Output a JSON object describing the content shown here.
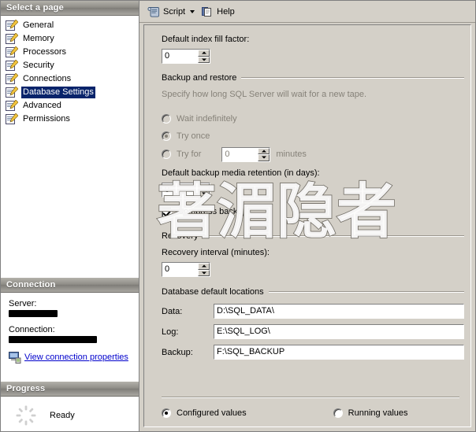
{
  "sidebar": {
    "header": "Select a page",
    "items": [
      {
        "label": "General",
        "icon": "page-script-icon",
        "selected": false
      },
      {
        "label": "Memory",
        "icon": "page-script-icon",
        "selected": false
      },
      {
        "label": "Processors",
        "icon": "page-script-icon",
        "selected": false
      },
      {
        "label": "Security",
        "icon": "page-script-icon",
        "selected": false
      },
      {
        "label": "Connections",
        "icon": "page-script-icon",
        "selected": false
      },
      {
        "label": "Database Settings",
        "icon": "page-script-icon",
        "selected": true
      },
      {
        "label": "Advanced",
        "icon": "page-script-icon",
        "selected": false
      },
      {
        "label": "Permissions",
        "icon": "page-script-icon",
        "selected": false
      }
    ],
    "selected_highlight_color": "#08246b"
  },
  "connection": {
    "header": "Connection",
    "server_label": "Server:",
    "server_value": "",
    "connection_label": "Connection:",
    "connection_value": "",
    "view_properties_link": "View connection properties",
    "link_color": "#0000cc",
    "icon": "server-connection-icon"
  },
  "progress": {
    "header": "Progress",
    "status": "Ready",
    "spinner_icon": "progress-spinner-icon"
  },
  "toolbar": {
    "script_label": "Script",
    "script_icon": "script-scroll-icon",
    "script_dropdown_icon": "chevron-down-icon",
    "help_label": "Help",
    "help_icon": "help-pages-icon"
  },
  "main": {
    "fill_factor": {
      "label": "Default index fill factor:",
      "value": "0"
    },
    "backup_restore": {
      "group_label": "Backup and restore",
      "description": "Specify how long SQL Server will wait for a new tape.",
      "options": [
        {
          "label": "Wait indefinitely",
          "checked": false,
          "disabled": true
        },
        {
          "label": "Try once",
          "checked": true,
          "disabled": true
        },
        {
          "label": "Try for",
          "checked": false,
          "disabled": true
        }
      ],
      "try_for_value": "0",
      "try_for_unit": "minutes",
      "retention_label": "Default backup media retention (in days):",
      "retention_value": "0",
      "compress_backup_label": "Compress backup",
      "compress_backup_checked": true
    },
    "recovery": {
      "group_label": "Recovery",
      "interval_label": "Recovery interval (minutes):",
      "interval_value": "0"
    },
    "default_locations": {
      "group_label": "Database default locations",
      "rows": [
        {
          "label": "Data:",
          "value": "D:\\SQL_DATA\\"
        },
        {
          "label": "Log:",
          "value": "E:\\SQL_LOG\\"
        },
        {
          "label": "Backup:",
          "value": "F:\\SQL_BACKUP"
        }
      ]
    },
    "value_mode": {
      "configured_label": "Configured values",
      "configured_checked": true,
      "running_label": "Running values",
      "running_checked": false
    }
  },
  "watermark": {
    "text": "著湄隐者"
  }
}
